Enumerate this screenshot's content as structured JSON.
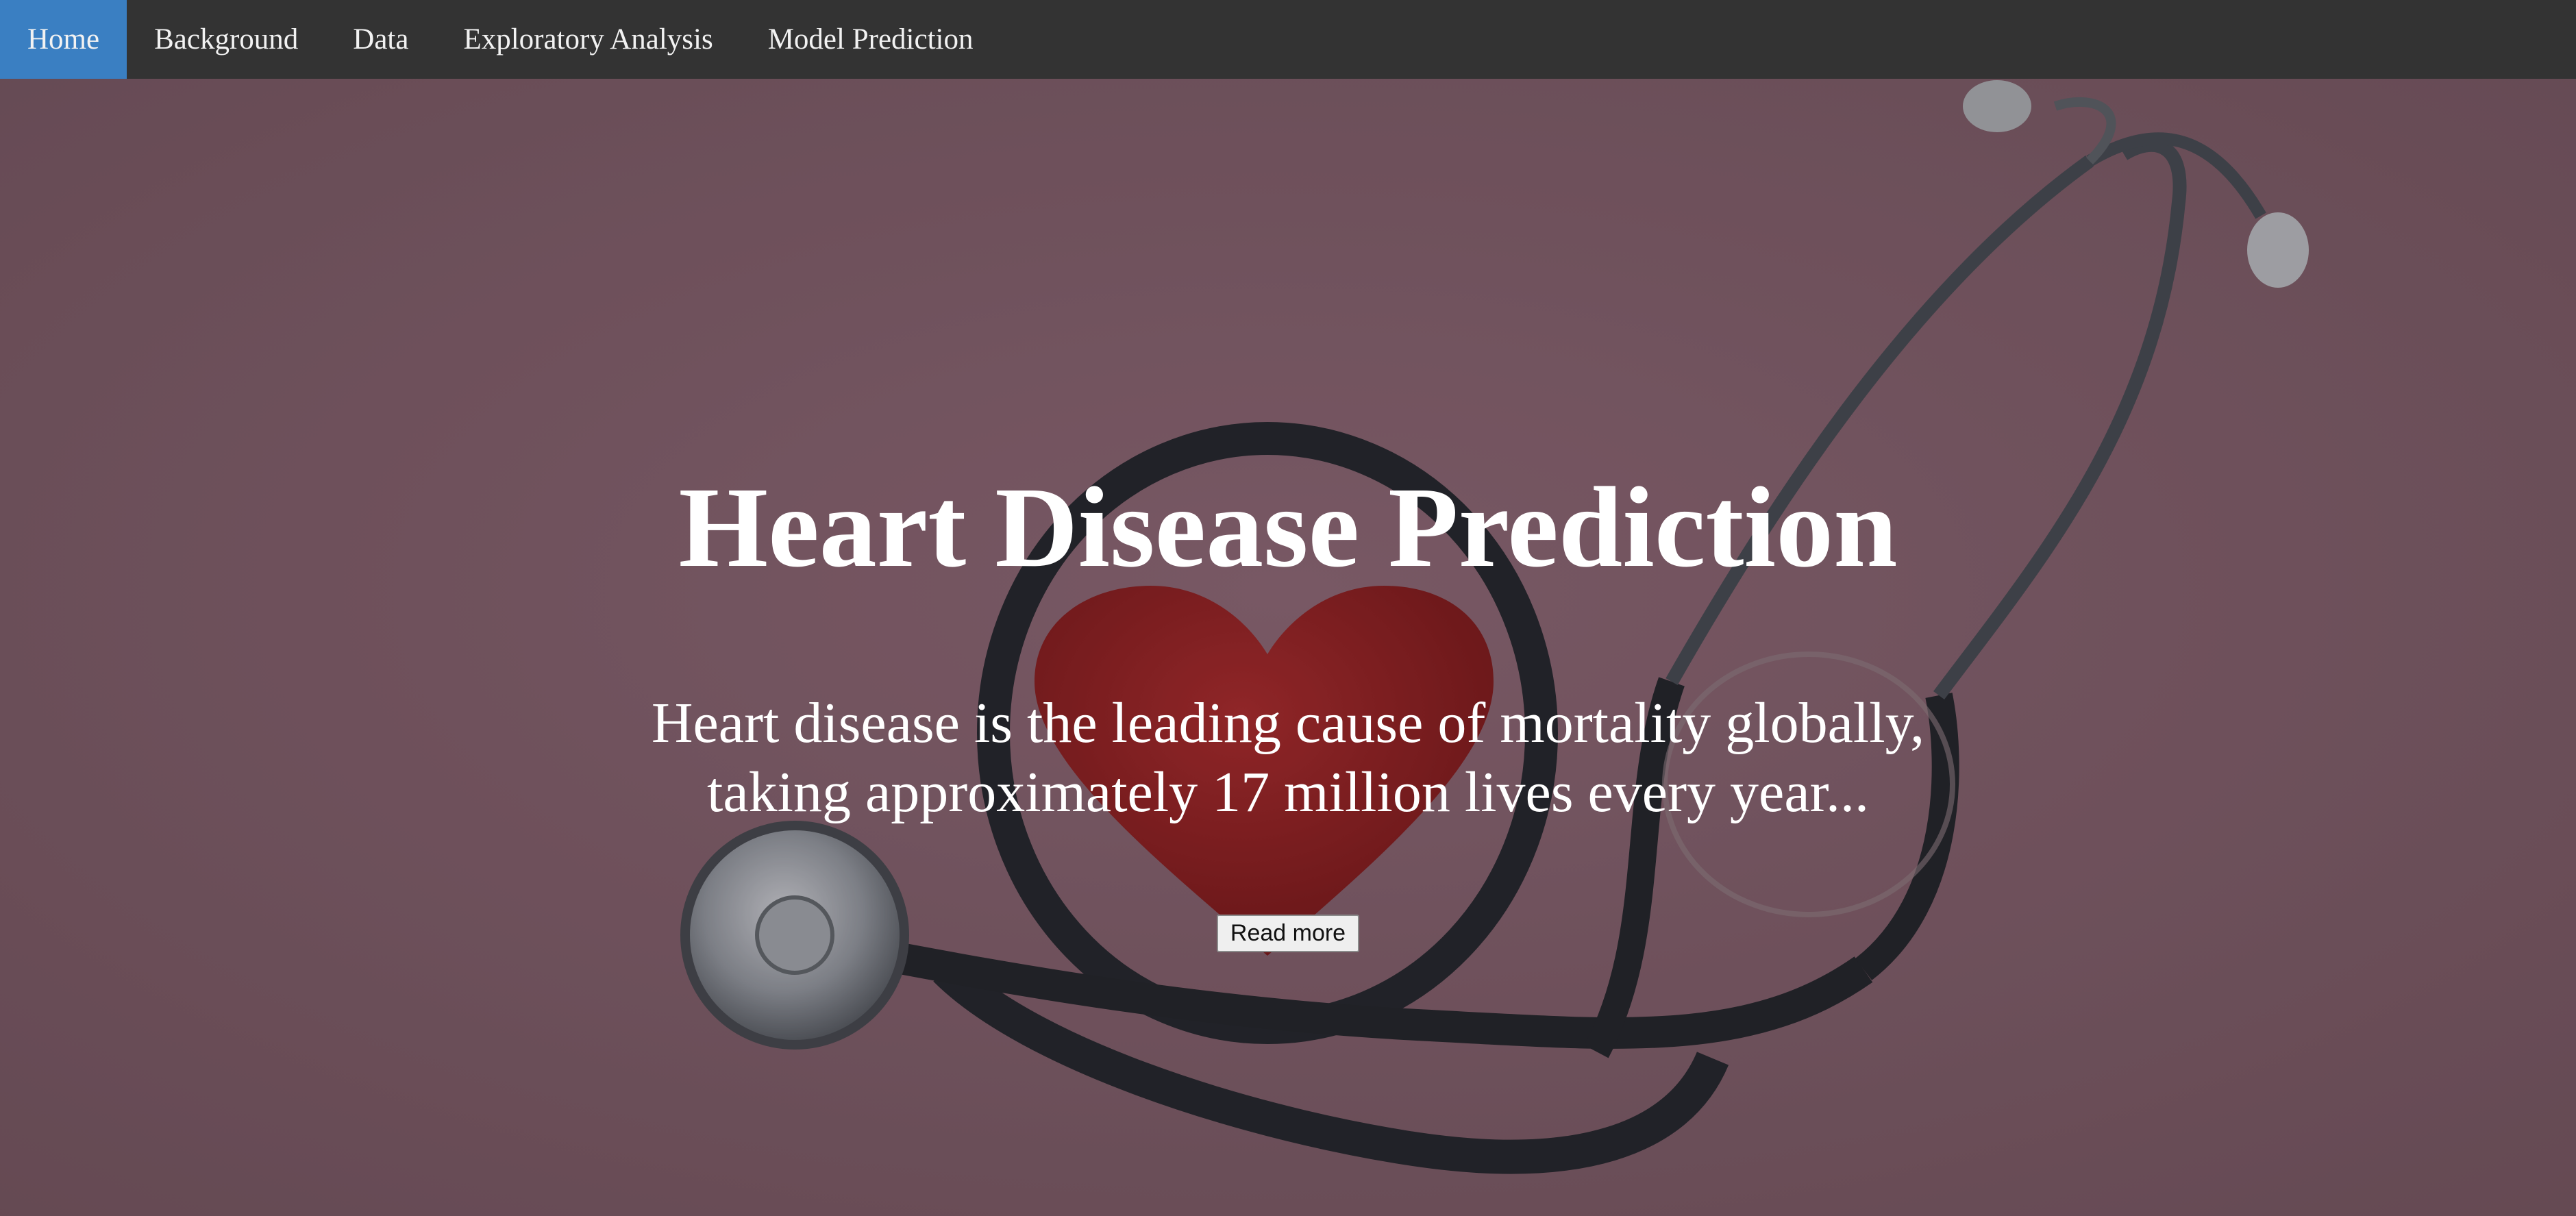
{
  "nav": {
    "items": [
      {
        "label": "Home",
        "active": true
      },
      {
        "label": "Background",
        "active": false
      },
      {
        "label": "Data",
        "active": false
      },
      {
        "label": "Exploratory Analysis",
        "active": false
      },
      {
        "label": "Model Prediction",
        "active": false
      }
    ]
  },
  "hero": {
    "title": "Heart Disease Prediction",
    "description": "Heart disease is the leading cause of mortality globally, taking approximately 17 million lives every year...",
    "button_label": "Read more",
    "background_image": "stethoscope-and-red-heart"
  },
  "colors": {
    "navbar": "#333333",
    "nav_active": "#3a7fc2",
    "background": "#7a5d68",
    "heart": "#8e1a1a",
    "stethoscope": "#1f262b"
  }
}
